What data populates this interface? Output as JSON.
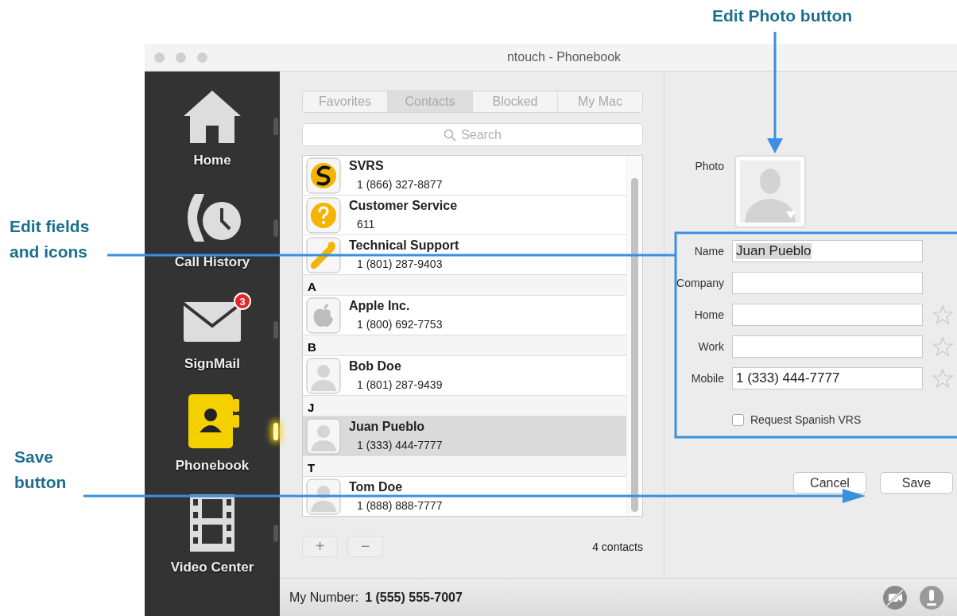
{
  "annotations": [
    {
      "kind": "photo",
      "text": "Edit Photo button"
    },
    {
      "kind": "fields",
      "text": "Edit fields and icons"
    },
    {
      "kind": "save",
      "text": "Save button"
    }
  ],
  "window": {
    "title": "ntouch - Phonebook"
  },
  "sidebar": {
    "items": [
      {
        "kind": "home",
        "label": "Home",
        "selected": false
      },
      {
        "kind": "history",
        "label": "Call History",
        "selected": false
      },
      {
        "kind": "mail",
        "label": "SignMail",
        "badge": "3",
        "selected": false
      },
      {
        "kind": "book",
        "label": "Phonebook",
        "selected": true
      },
      {
        "kind": "film",
        "label": "Video Center",
        "selected": false
      }
    ]
  },
  "tabs": [
    {
      "label": "Favorites",
      "selected": false
    },
    {
      "label": "Contacts",
      "selected": true
    },
    {
      "label": "Blocked",
      "selected": false
    },
    {
      "label": "My Mac",
      "selected": false
    }
  ],
  "search": {
    "placeholder": "Search"
  },
  "contacts": [
    {
      "kind": "service",
      "name": "SVRS",
      "number": "1 (866) 327-8877",
      "selected": false
    },
    {
      "kind": "help",
      "name": "Customer Service",
      "number": "611",
      "selected": false
    },
    {
      "kind": "tool",
      "name": "Technical Support",
      "number": "1 (801) 287-9403",
      "selected": false
    },
    {
      "kind": "section",
      "name": "A"
    },
    {
      "kind": "company",
      "name": "Apple Inc.",
      "number": "1 (800) 692-7753",
      "selected": false
    },
    {
      "kind": "section",
      "name": "B"
    },
    {
      "kind": "person",
      "name": "Bob Doe",
      "number": "1 (801) 287-9439",
      "selected": false
    },
    {
      "kind": "section",
      "name": "J"
    },
    {
      "kind": "person",
      "name": "Juan Pueblo",
      "number": "1 (333) 444-7777",
      "selected": true
    },
    {
      "kind": "section",
      "name": "T"
    },
    {
      "kind": "person",
      "name": "Tom Doe",
      "number": "1 (888) 888-7777",
      "selected": false
    }
  ],
  "list_buttons": [
    "+",
    "−"
  ],
  "contact_count": "4 contacts",
  "editor": {
    "photo_label": "Photo",
    "fields": [
      {
        "label": "Name",
        "value": "Juan Pueblo",
        "text_selected": true
      },
      {
        "label": "Company"
      },
      {
        "label": "Home",
        "favorite": false
      },
      {
        "label": "Work",
        "favorite": false
      },
      {
        "label": "Mobile",
        "value": "1 (333) 444-7777",
        "text_selected": false,
        "favorite": false
      }
    ],
    "checkbox": {
      "label": "Request Spanish VRS",
      "checked": false
    },
    "buttons": [
      "Cancel",
      "Save"
    ]
  },
  "status_bar": {
    "label": "My Number:",
    "number": "1 (555) 555-7007"
  }
}
